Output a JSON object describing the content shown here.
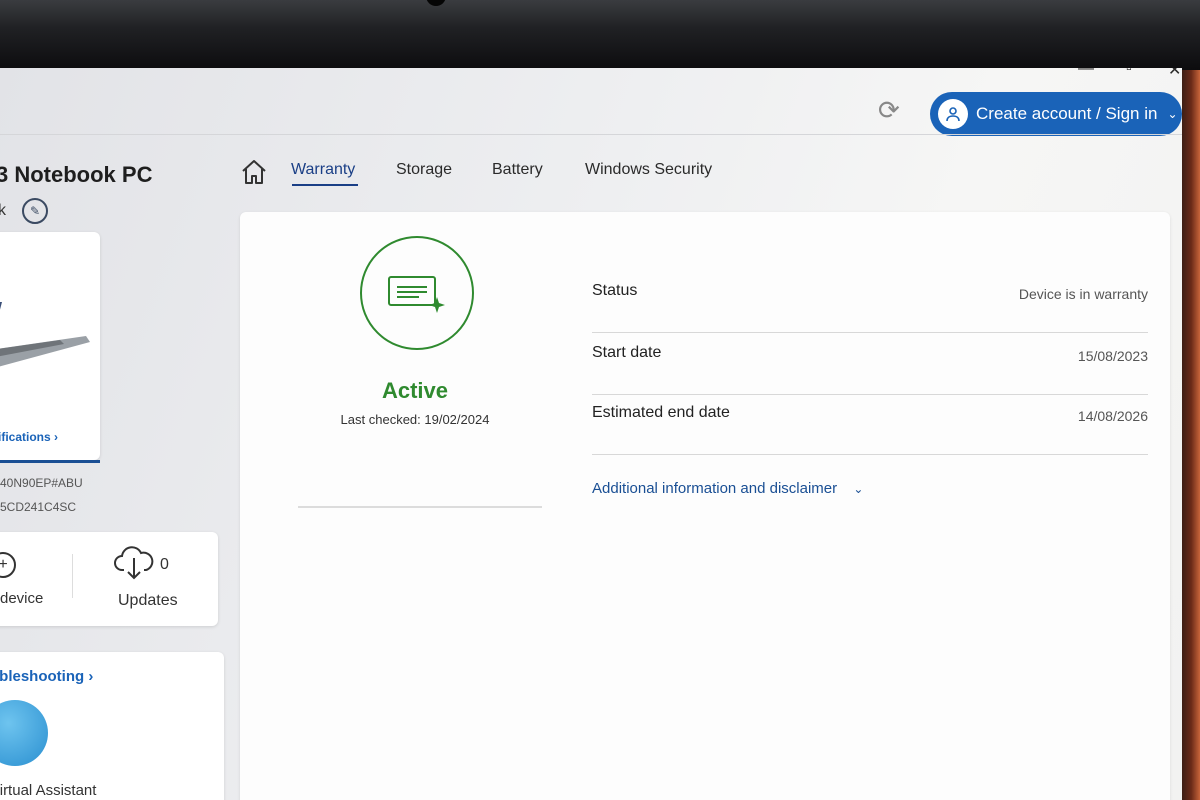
{
  "topbar": {
    "signin_label": "Create account / Sign in"
  },
  "device": {
    "title": "3 Notebook PC",
    "subtitle": "k",
    "specs_link": "ifications ›",
    "model": "40N90EP#ABU",
    "serial": "5CD241C4SC"
  },
  "stats": {
    "device_label": "device",
    "updates_count": "0",
    "updates_label": "Updates"
  },
  "troubleshooting": {
    "title": "ubleshooting ›",
    "assistant_label": "Virtual Assistant"
  },
  "tabs": [
    {
      "label": "Warranty",
      "active": true
    },
    {
      "label": "Storage",
      "active": false
    },
    {
      "label": "Battery",
      "active": false
    },
    {
      "label": "Windows Security",
      "active": false
    }
  ],
  "warranty": {
    "state": "Active",
    "last_checked": "Last checked: 19/02/2024",
    "rows": [
      {
        "key": "Status",
        "value": "Device is in warranty"
      },
      {
        "key": "Start date",
        "value": "15/08/2023"
      },
      {
        "key": "Estimated end date",
        "value": "14/08/2026"
      }
    ],
    "disclaimer_link": "Additional information and disclaimer"
  },
  "colors": {
    "accent": "#1a63b8",
    "active_green": "#2f8a2f"
  }
}
